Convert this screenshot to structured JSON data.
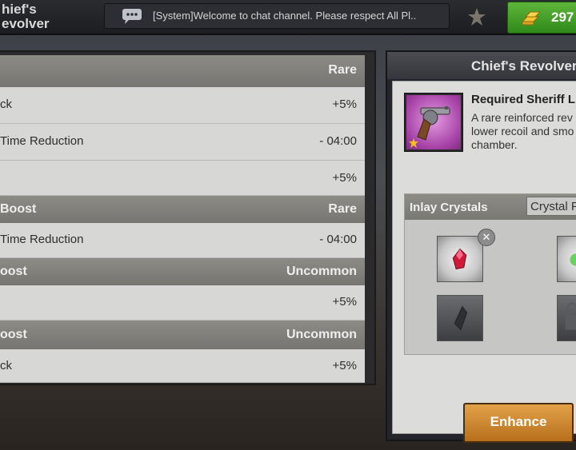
{
  "header": {
    "title_line1": "hief's",
    "title_line2": "evolver",
    "chat_text": "[System]Welcome to chat channel. Please respect All Pl..",
    "gold_amount": "297"
  },
  "left_list": [
    {
      "kind": "header",
      "label": "",
      "value": "Rare"
    },
    {
      "kind": "stat",
      "label": "ck",
      "value": "+5%"
    },
    {
      "kind": "stat",
      "label": "Time Reduction",
      "value": "- 04:00"
    },
    {
      "kind": "stat",
      "label": "",
      "value": "+5%"
    },
    {
      "kind": "header",
      "label": "Boost",
      "value": "Rare"
    },
    {
      "kind": "stat",
      "label": "Time Reduction",
      "value": "- 04:00"
    },
    {
      "kind": "header",
      "label": "oost",
      "value": "Uncommon"
    },
    {
      "kind": "stat",
      "label": "",
      "value": "+5%"
    },
    {
      "kind": "header",
      "label": "oost",
      "value": "Uncommon"
    },
    {
      "kind": "stat",
      "label": "ck",
      "value": "+5%"
    }
  ],
  "detail": {
    "title": "Chief's Revolver",
    "item_name": "Required Sheriff L",
    "item_desc": "A rare reinforced rev\nlower recoil and smo\nchamber.",
    "item_icon": "revolver-icon",
    "inlay_title": "Inlay Crystals",
    "crystal_button": "Crystal F",
    "enhance_label": "Enhance"
  },
  "colors": {
    "gold_button": "#3f9d27",
    "enhance_button": "#d08a35",
    "item_background": "#a742a8"
  }
}
